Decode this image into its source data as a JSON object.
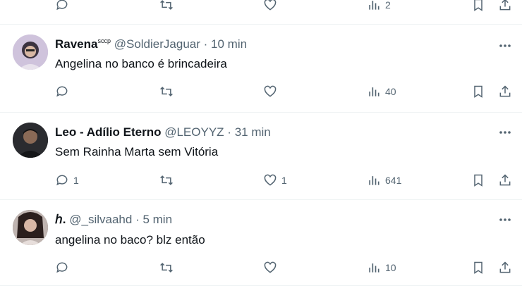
{
  "top_partial": {
    "views": "2"
  },
  "tweets": [
    {
      "name": "Ravena",
      "name_suffix": "scсp",
      "handle": "@SoldierJaguar",
      "separator": "·",
      "time": "10 min",
      "text": "Angelina no banco é brincadeira",
      "replies": "",
      "retweets": "",
      "likes": "",
      "views": "40"
    },
    {
      "name": "Leo - Adílio Eterno",
      "name_suffix": "",
      "handle": "@LEOYYZ",
      "separator": "·",
      "time": "31 min",
      "text": "Sem Rainha Marta sem Vitória",
      "replies": "1",
      "retweets": "",
      "likes": "1",
      "views": "641"
    },
    {
      "name": "ℎ.",
      "name_suffix": "",
      "handle": "@_silvaahd",
      "separator": "·",
      "time": "5 min",
      "text": "angelina no baco? blz então",
      "replies": "",
      "retweets": "",
      "likes": "",
      "views": "10"
    }
  ],
  "icons": {
    "reply": "reply-icon",
    "retweet": "retweet-icon",
    "like": "heart-icon",
    "views": "views-chart-icon",
    "bookmark": "bookmark-icon",
    "share": "share-icon",
    "more": "more-options-icon"
  },
  "colors": {
    "text": "#0f1419",
    "secondary": "#536471",
    "divider": "#eff3f4"
  }
}
